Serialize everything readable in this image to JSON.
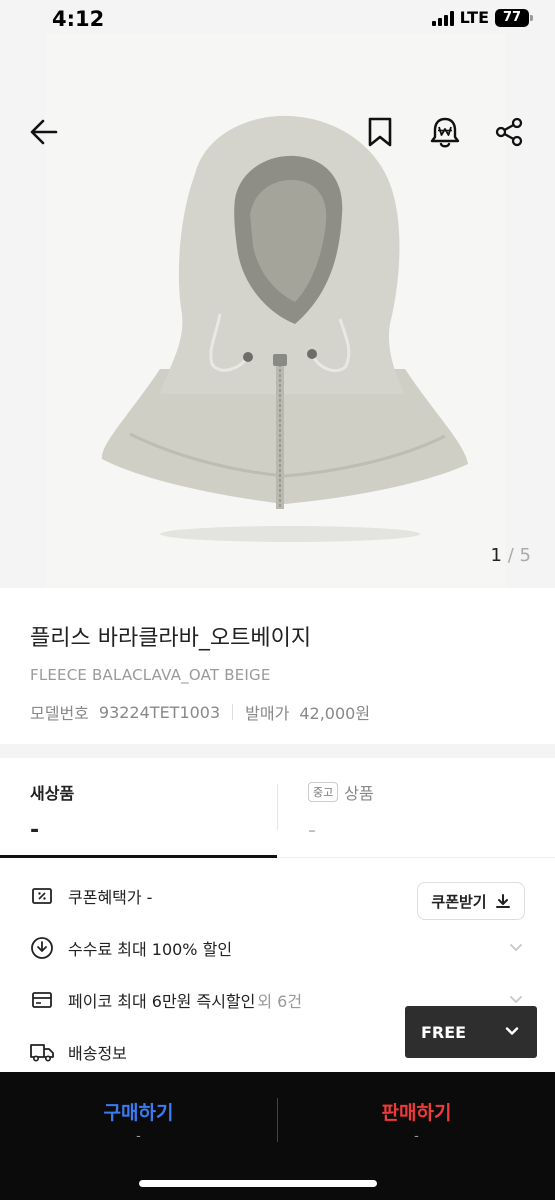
{
  "status": {
    "time": "4:12",
    "network": "LTE",
    "battery": "77"
  },
  "nav": {
    "back_icon": "arrow-left-icon",
    "bookmark_icon": "bookmark-icon",
    "alert_icon": "price-alert-bell-icon",
    "share_icon": "share-icon"
  },
  "gallery": {
    "current": "1",
    "separator": "/",
    "total": "5"
  },
  "product": {
    "name_ko": "플리스 바라클라바_오트베이지",
    "name_en": "FLEECE BALACLAVA_OAT BEIGE",
    "model_label": "모델번호",
    "model_value": "93224TET1003",
    "release_label": "발매가",
    "release_value": "42,000원"
  },
  "tabs": {
    "new_label": "새상품",
    "new_price": "-",
    "used_badge": "중고",
    "used_label": "상품",
    "used_price": "-"
  },
  "benefits": {
    "coupon_label": "쿠폰혜택가 -",
    "coupon_button": "쿠폰받기",
    "fee_label": "수수료 최대 100% 할인",
    "pay_label": "페이코 최대 6만원 즉시할인",
    "pay_sub": "외 6건",
    "shipping_label": "배송정보"
  },
  "size_dropdown": {
    "value": "FREE"
  },
  "actions": {
    "buy_label": "구매하기",
    "buy_price": "-",
    "sell_label": "판매하기",
    "sell_price": "-"
  },
  "colors": {
    "buy": "#3a7bf0",
    "sell": "#ef3a3a",
    "bar": "#0b0b0b"
  }
}
